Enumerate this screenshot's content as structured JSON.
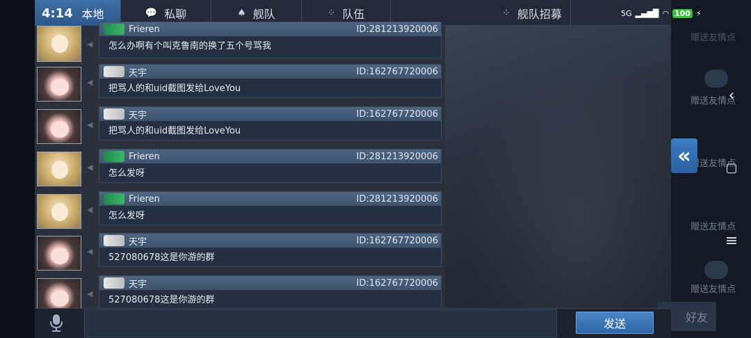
{
  "status": {
    "time": "4:14",
    "network": "5G",
    "battery": "100"
  },
  "tabs": [
    {
      "label": "本地",
      "icon": "globe-icon",
      "active": true
    },
    {
      "label": "私聊",
      "icon": "chat-bubble-icon",
      "active": false
    },
    {
      "label": "舰队",
      "icon": "fleet-icon",
      "active": false
    },
    {
      "label": "队伍",
      "icon": "team-icon",
      "active": false
    },
    {
      "label": "舰队招募",
      "icon": "recruit-icon",
      "active": false
    }
  ],
  "messages": [
    {
      "sender": "Frieren",
      "uid": "ID:281213920006",
      "text": "怎么办啊有个叫克鲁南的换了五个号骂我",
      "avatar": "frieren"
    },
    {
      "sender": "天宇",
      "uid": "ID:162767720006",
      "text": "把骂人的和uid截图发给LoveYou",
      "avatar": "tianyu"
    },
    {
      "sender": "天宇",
      "uid": "ID:162767720006",
      "text": "把骂人的和uid截图发给LoveYou",
      "avatar": "tianyu"
    },
    {
      "sender": "Frieren",
      "uid": "ID:281213920006",
      "text": "怎么发呀",
      "avatar": "frieren"
    },
    {
      "sender": "Frieren",
      "uid": "ID:281213920006",
      "text": "怎么发呀",
      "avatar": "frieren"
    },
    {
      "sender": "天宇",
      "uid": "ID:162767720006",
      "text": "527080678这是你游的群",
      "avatar": "tianyu"
    },
    {
      "sender": "天宇",
      "uid": "ID:162767720006",
      "text": "527080678这是你游的群",
      "avatar": "tianyu"
    }
  ],
  "side_panel": {
    "labels": [
      "赠送友情点",
      "赠送友情点",
      "赠送友情点",
      "赠送友情点",
      "赠送友情点"
    ],
    "button": "好友"
  },
  "composer": {
    "send_label": "发送"
  },
  "colors": {
    "accent": "#3d6ea6",
    "battery": "#3bbf3b",
    "bubble_header": "#4e6480"
  }
}
